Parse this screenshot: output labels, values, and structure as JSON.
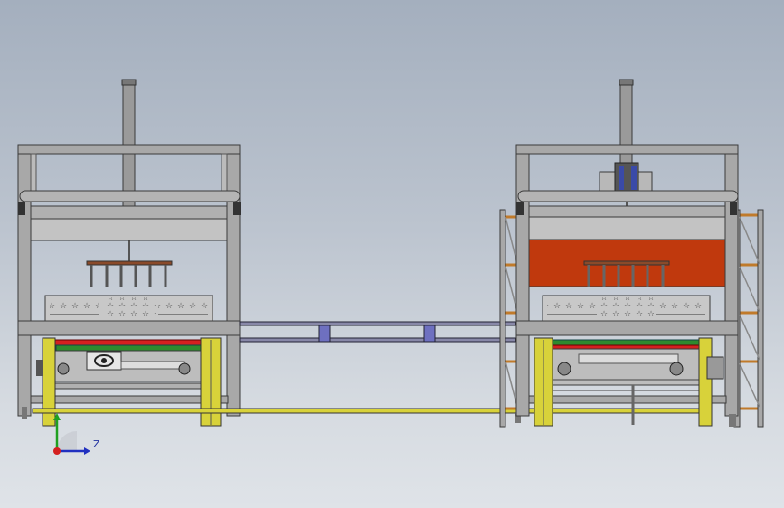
{
  "viewport": {
    "background_top": "#a4afbe",
    "background_bottom": "#dfe3e8"
  },
  "model": {
    "frame_color": "#a8a8a8",
    "frame_edge_color": "#3a3a3a",
    "heater_color": "#c0390d",
    "yellow_post_color": "#d8d23a",
    "red_rail_color": "#d42020",
    "green_rail_color": "#2e8a2e",
    "rack_color": "#c07a2a",
    "blue_block_color": "#6e70c0",
    "stations": [
      "left-station",
      "right-station"
    ]
  },
  "triad": {
    "y_axis_label": "",
    "z_axis_label": "Z",
    "x_axis_color": "#d42020",
    "y_axis_color": "#20a020",
    "z_axis_color": "#2030c0"
  }
}
